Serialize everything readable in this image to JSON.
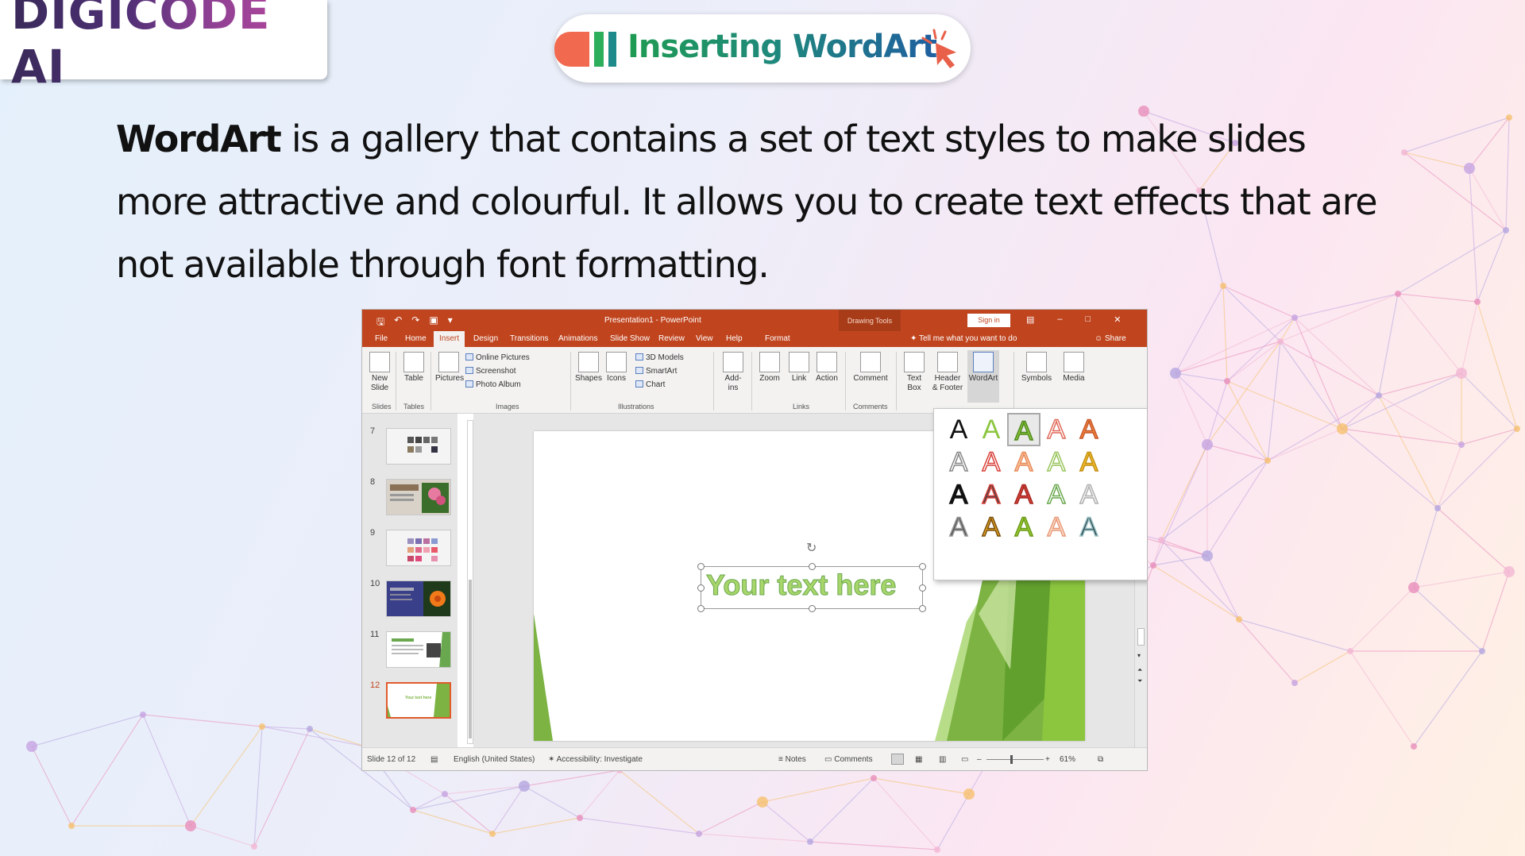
{
  "logo": {
    "text": "DIGICODE AI"
  },
  "title": {
    "text": "Inserting WordArt"
  },
  "paragraph": {
    "bold": "WordArt",
    "rest": " is a gallery that contains a set of text styles to make slides more attractive and colourful. It allows you to create text effects that are not available through font formatting."
  },
  "ppt": {
    "window_title": "Presentation1  -  PowerPoint",
    "drawing_tools": "Drawing Tools",
    "sign_in": "Sign in",
    "tabs": [
      "File",
      "Home",
      "Insert",
      "Design",
      "Transitions",
      "Animations",
      "Slide Show",
      "Review",
      "View",
      "Help",
      "Format"
    ],
    "active_tab": "Insert",
    "tell_me": "Tell me what you want to do",
    "share": "Share",
    "ribbon": {
      "new_slide": "New\nSlide",
      "table": "Table",
      "pictures": "Pictures",
      "online_pictures": "Online Pictures",
      "screenshot": "Screenshot",
      "photo_album": "Photo Album",
      "shapes": "Shapes",
      "icons": "Icons",
      "models_3d": "3D Models",
      "smartart": "SmartArt",
      "chart": "Chart",
      "addins": "Add-\nins",
      "zoom": "Zoom",
      "link": "Link",
      "action": "Action",
      "comment": "Comment",
      "text_box": "Text\nBox",
      "header_footer": "Header\n& Footer",
      "wordart": "WordArt",
      "symbols": "Symbols",
      "media": "Media",
      "groups": {
        "slides": "Slides",
        "tables": "Tables",
        "images": "Images",
        "illustrations": "Illustrations",
        "links": "Links",
        "comments": "Comments"
      }
    },
    "slide_numbers": [
      "7",
      "8",
      "9",
      "10",
      "11",
      "12"
    ],
    "current_slide": "12",
    "thumb12_text": "Your text here",
    "slide_placeholder": "Your text here",
    "status": {
      "slide_count": "Slide 12 of 12",
      "language": "English (United States)",
      "accessibility": "Accessibility: Investigate",
      "notes": "Notes",
      "comments": "Comments",
      "zoom": "61%"
    },
    "gallery": {
      "glyph": "A",
      "selected_index": 2,
      "styles": [
        {
          "fill": "#111111",
          "stroke": "none"
        },
        {
          "fill": "#8cc63f",
          "stroke": "none"
        },
        {
          "fill": "#8cc63f",
          "stroke": "#4f8a1c"
        },
        {
          "fill": "#ffffff",
          "stroke": "#e06a5a"
        },
        {
          "fill": "#f08a3c",
          "stroke": "#c8552a"
        },
        {
          "fill": "#ffffff",
          "stroke": "#888888"
        },
        {
          "fill": "#ffffff",
          "stroke": "#d9413a"
        },
        {
          "fill": "#fbc9a4",
          "stroke": "#e88a5a"
        },
        {
          "fill": "#ffffff",
          "stroke": "#9ac55e"
        },
        {
          "fill": "#f2c230",
          "stroke": "#c58e12"
        },
        {
          "fill": "#111111",
          "stroke": "#111111"
        },
        {
          "fill": "#444444",
          "stroke": "#d9413a"
        },
        {
          "fill": "#d9413a",
          "stroke": "#a52a22"
        },
        {
          "fill": "#ffffff",
          "stroke": "#6aa84f"
        },
        {
          "fill": "#f4f4f4",
          "stroke": "#b0b0b0"
        },
        {
          "fill": "#555555",
          "stroke": "#999999"
        },
        {
          "fill": "#e0a020",
          "stroke": "#7a5010"
        },
        {
          "fill": "#9acd32",
          "stroke": "#6b9a1a"
        },
        {
          "fill": "#fde0cf",
          "stroke": "#e89a7a"
        },
        {
          "fill": "#2b4a4f",
          "stroke": "#9ec4c8"
        }
      ]
    }
  }
}
